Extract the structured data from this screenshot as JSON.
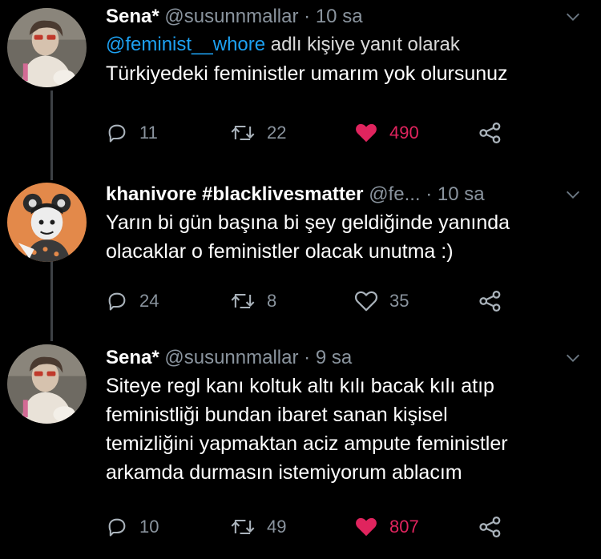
{
  "theme": {
    "background": "#000000",
    "text": "#ffffff",
    "muted": "#8a949e",
    "link": "#1da1f2",
    "like": "#e0245e",
    "thread_line": "#3d4145"
  },
  "tweets": [
    {
      "name": "Sena*",
      "handle": "@susunnmallar",
      "dot": "·",
      "time": "10 sa",
      "reply_mention": "@feminist__whore",
      "reply_suffix": "adlı kişiye yanıt olarak",
      "text_lines": [
        "Türkiyedeki feministler umarım yok olursunuz"
      ],
      "reply_count": "11",
      "retweet_count": "22",
      "like_count": "490",
      "liked": true,
      "avatar_icon": "profile-photo-avatar"
    },
    {
      "name": "khanivore #blacklivesmatter",
      "handle": "@fe...",
      "dot": "·",
      "time": "10 sa",
      "text_lines": [
        "Yarın bi gün başına bi şey geldiğinde yanında",
        "olacaklar o feministler olacak unutma :)"
      ],
      "reply_count": "24",
      "retweet_count": "8",
      "like_count": "35",
      "liked": false,
      "avatar_icon": "illustrated-character-avatar"
    },
    {
      "name": "Sena*",
      "handle": "@susunnmallar",
      "dot": "·",
      "time": "9 sa",
      "text_lines": [
        "Siteye regl kanı koltuk altı kılı bacak kılı atıp",
        "feministliği bundan ibaret sanan kişisel",
        "temizliğini yapmaktan aciz ampute feministler",
        "arkamda durmasın istemiyorum ablacım"
      ],
      "reply_count": "10",
      "retweet_count": "49",
      "like_count": "807",
      "liked": true,
      "avatar_icon": "profile-photo-avatar"
    }
  ]
}
